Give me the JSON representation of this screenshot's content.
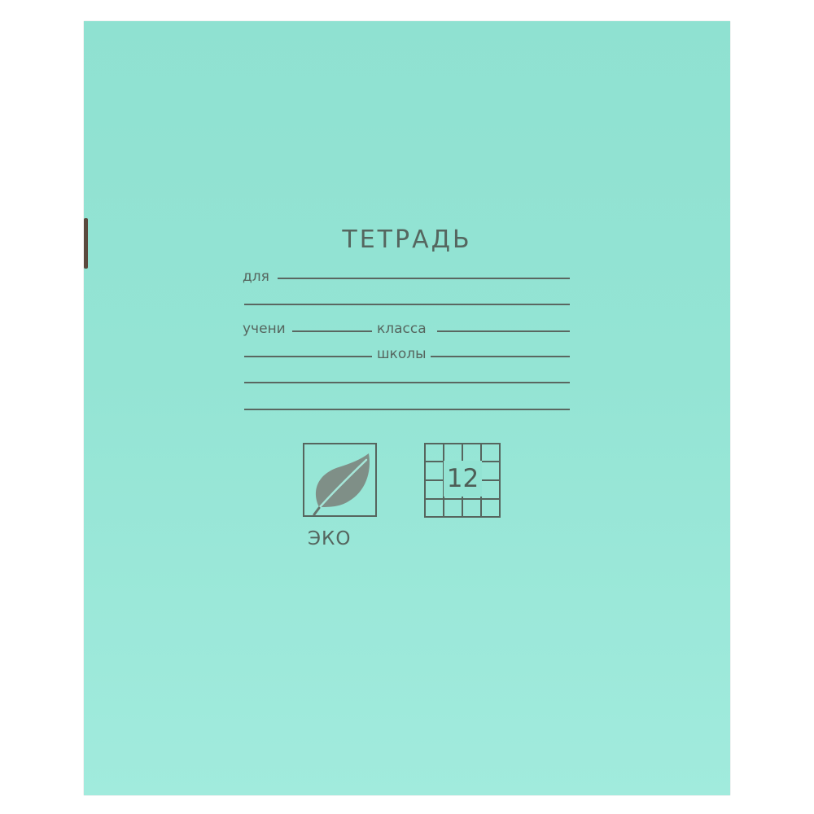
{
  "notebook_cover": {
    "title": "ТЕТРАДЬ",
    "fields": {
      "for_label": "для",
      "student_label": "учени",
      "class_label": "класса",
      "school_label": "школы"
    },
    "badges": {
      "eco_label": "ЭКО",
      "eco_icon": "leaf-icon",
      "grid_icon": "grid-icon",
      "sheet_count": "12"
    },
    "colors": {
      "cover": "#94e4d4",
      "ink": "#56655e"
    }
  }
}
